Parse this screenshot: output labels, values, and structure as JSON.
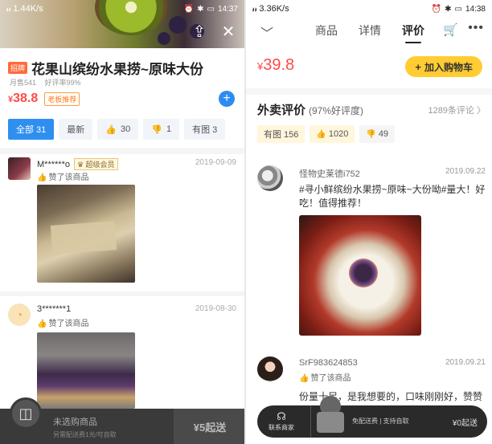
{
  "left": {
    "status": {
      "signal": "ᵢₗₗ ᵢₗₗ",
      "speed": "1.44K/s",
      "time": "14:37"
    },
    "product": {
      "tag": "招牌",
      "title": "花果山缤纷水果捞~原味大份",
      "monthly_sales": "月售541",
      "good_rate": "好评率99%",
      "currency": "¥",
      "price": "38.8",
      "boss_tag": "老板推荐"
    },
    "filters": [
      {
        "label": "全部 31",
        "icon": ""
      },
      {
        "label": "最新",
        "icon": ""
      },
      {
        "label": "30",
        "icon": "thumbs-up-icon"
      },
      {
        "label": "1",
        "icon": "thumbs-down-icon"
      },
      {
        "label": "有图 3",
        "icon": ""
      }
    ],
    "reviews": [
      {
        "name": "M******o",
        "vip": "超级会员",
        "date": "2019-09-09",
        "liked": "赞了该商品"
      },
      {
        "name": "3*******1",
        "vip": "",
        "date": "2019-08-30",
        "liked": "赞了该商品"
      }
    ],
    "cart": {
      "label": "未选购商品",
      "sub": "另需配送费1元/可自取",
      "send": "¥5起送"
    }
  },
  "right": {
    "status": {
      "speed": "3.36K/s",
      "time": "14:38"
    },
    "tabs": [
      "商品",
      "详情",
      "评价"
    ],
    "active_tab": "评价",
    "currency": "¥",
    "price": "39.8",
    "add_cart": "加入购物车",
    "section": {
      "title": "外卖评价",
      "good": "(97%好评度)",
      "count": "1289条评论"
    },
    "chips": [
      {
        "label": "有图 156",
        "icon": ""
      },
      {
        "label": "1020",
        "icon": "thumbs-up-icon"
      },
      {
        "label": "49",
        "icon": "thumbs-down-icon"
      }
    ],
    "reviews": [
      {
        "name": "怪物史莱德i752",
        "date": "2019.09.22",
        "text": "#寻小鲜缤纷水果捞~原味~大份呦#量大！好吃！值得推荐！"
      },
      {
        "name": "SrF983624853",
        "date": "2019.09.21",
        "liked": "赞了该商品",
        "text": "份量十足，是我想要的，口味刚刚好，赞赞"
      }
    ],
    "bar": {
      "merchant": "联系商家",
      "info": "免配送费 | 支持自取",
      "send": "¥0起送"
    }
  }
}
